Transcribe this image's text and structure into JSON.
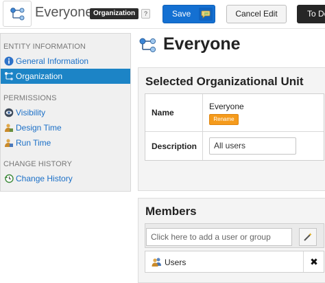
{
  "header": {
    "entity_title": "Everyone",
    "entity_type_badge": "Organization",
    "help_label": "?",
    "save_label": "Save",
    "cancel_label": "Cancel Edit",
    "todo_label": "To Do"
  },
  "sidebar": {
    "sections": [
      {
        "title": "ENTITY INFORMATION",
        "items": [
          {
            "label": "General Information",
            "icon": "info-icon"
          },
          {
            "label": "Organization",
            "icon": "org-icon",
            "active": true
          }
        ]
      },
      {
        "title": "PERMISSIONS",
        "items": [
          {
            "label": "Visibility",
            "icon": "eye-icon"
          },
          {
            "label": "Design Time",
            "icon": "design-time-icon"
          },
          {
            "label": "Run Time",
            "icon": "run-time-icon"
          }
        ]
      },
      {
        "title": "CHANGE HISTORY",
        "items": [
          {
            "label": "Change History",
            "icon": "history-icon"
          }
        ]
      }
    ]
  },
  "main": {
    "title": "Everyone",
    "org_unit": {
      "title": "Selected Organizational Unit",
      "name_label": "Name",
      "name_value": "Everyone",
      "rename_label": "Rename",
      "description_label": "Description",
      "description_value": "All users"
    },
    "members": {
      "title": "Members",
      "add_placeholder": "Click here to add a user or group",
      "list": [
        {
          "name": "Users",
          "icon": "user-group-icon"
        }
      ],
      "remove_label": "✖"
    }
  },
  "colors": {
    "primary_blue": "#1470d2",
    "active_nav": "#1c84c6",
    "rename_orange": "#f59b1c",
    "badge_dark": "#2b2b2b"
  }
}
